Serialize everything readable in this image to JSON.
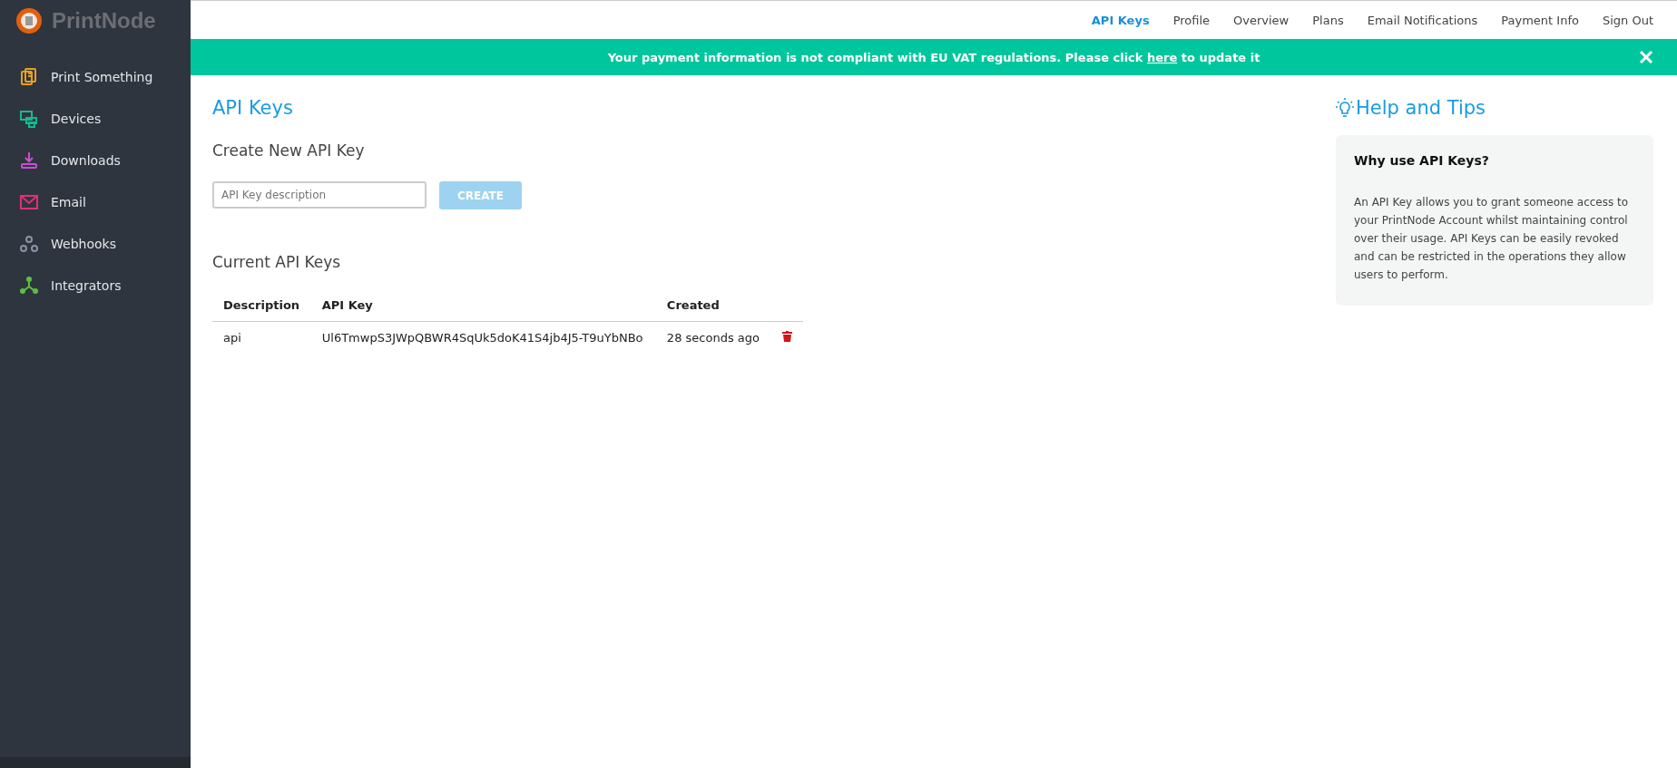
{
  "logo": {
    "text": "PrintNode"
  },
  "sidebar": {
    "items": [
      {
        "label": "Print Something",
        "kind": "print"
      },
      {
        "label": "Devices",
        "kind": "devices"
      },
      {
        "label": "Downloads",
        "kind": "downloads"
      },
      {
        "label": "Email",
        "kind": "email"
      },
      {
        "label": "Webhooks",
        "kind": "webhooks"
      },
      {
        "label": "Integrators",
        "kind": "integrators"
      }
    ]
  },
  "nav": [
    {
      "label": "API Keys",
      "selected": true
    },
    {
      "label": "Profile",
      "selected": false
    },
    {
      "label": "Overview",
      "selected": false
    },
    {
      "label": "Plans",
      "selected": false
    },
    {
      "label": "Email Notifications",
      "selected": false
    },
    {
      "label": "Payment Info",
      "selected": false
    },
    {
      "label": "Sign Out",
      "selected": false
    }
  ],
  "banner": {
    "before": "Your payment information is not compliant with EU VAT regulations. Please click",
    "link": "here",
    "after": "to update it"
  },
  "page_title": "API Keys",
  "create": {
    "heading": "Create New API Key",
    "placeholder": "API Key description",
    "button": "CREATE",
    "disabled": true
  },
  "current": {
    "heading": "Current API Keys",
    "columns": [
      "Description",
      "API Key",
      "Created"
    ],
    "rows": [
      {
        "description": "api",
        "key": "Ul6TmwpS3JWpQBWR4SqUk5doK41S4jb4J5-T9uYbNBo",
        "created": "28 seconds ago"
      }
    ]
  },
  "help": {
    "title": "Help and Tips",
    "card_title": "Why use API Keys?",
    "text": "An API Key allows you to grant someone access to your PrintNode Account whilst maintaining control over their usage. API Keys can be easily revoked and can be restricted in the operations they allow users to perform."
  }
}
